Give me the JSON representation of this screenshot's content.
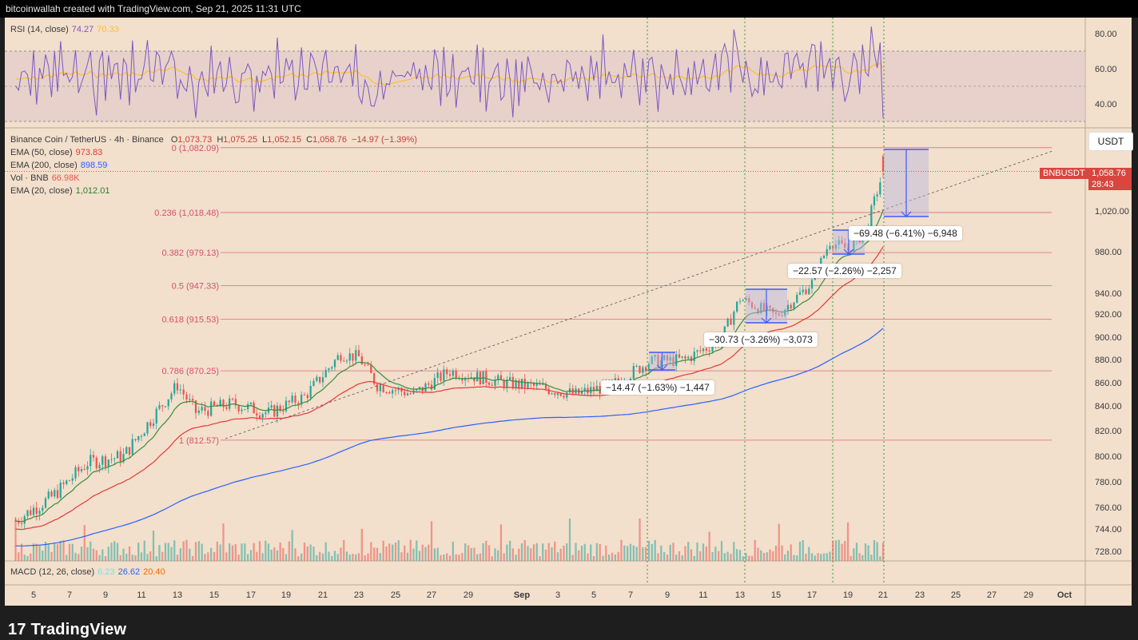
{
  "header": {
    "attribution": "bitcoinwallah created with TradingView.com, Sep 21, 2025 11:31 UTC"
  },
  "rsi": {
    "label": "RSI (14, close)",
    "value": "74.27",
    "ma_value": "70.33",
    "ticks": [
      "80.00",
      "60.00",
      "40.00"
    ]
  },
  "main": {
    "symbol": "Binance Coin / TetherUS · 4h · Binance",
    "ohlc": {
      "o_label": "O",
      "o": "1,073.73",
      "h_label": "H",
      "h": "1,075.25",
      "l_label": "L",
      "l": "1,052.15",
      "c_label": "C",
      "c": "1,058.76",
      "change": "−14.97 (−1.39%)"
    },
    "ema50": {
      "label": "EMA (50, close)",
      "value": "973.83"
    },
    "ema200": {
      "label": "EMA (200, close)",
      "value": "898.59"
    },
    "vol": {
      "label": "Vol · BNB",
      "value": "66.98K"
    },
    "ema20": {
      "label": "EMA (20, close)",
      "value": "1,012.01"
    },
    "currency": "USDT",
    "price_ticks": [
      "1,020.00",
      "980.00",
      "940.00",
      "920.00",
      "900.00",
      "880.00",
      "860.00",
      "840.00",
      "820.00",
      "800.00",
      "780.00",
      "760.00",
      "744.00",
      "728.00"
    ],
    "symbol_tag": "BNBUSDT",
    "last_price": "1,058.76",
    "countdown": "28:43",
    "fib_levels": [
      {
        "label": "0 (1,082.09)",
        "price": 1082.09
      },
      {
        "label": "0.236 (1,018.48)",
        "price": 1018.48
      },
      {
        "label": "0.382 (979.13)",
        "price": 979.13
      },
      {
        "label": "0.5 (947.33)",
        "price": 947.33
      },
      {
        "label": "0.618 (915.53)",
        "price": 915.53
      },
      {
        "label": "0.786 (870.25)",
        "price": 870.25
      },
      {
        "label": "1 (812.57)",
        "price": 812.57
      }
    ],
    "measurements": [
      {
        "text": "−14.47 (−1.63%) −1,447"
      },
      {
        "text": "−30.73 (−3.26%) −3,073"
      },
      {
        "text": "−22.57 (−2.26%) −2,257"
      },
      {
        "text": "−69.48 (−6.41%) −6,948"
      }
    ]
  },
  "macd": {
    "label": "MACD (12, 26, close)",
    "v1": "6.23",
    "v2": "26.62",
    "v3": "20.40"
  },
  "x_axis": {
    "labels": [
      "5",
      "7",
      "9",
      "11",
      "13",
      "15",
      "17",
      "19",
      "21",
      "23",
      "25",
      "27",
      "29",
      "Sep",
      "3",
      "5",
      "7",
      "9",
      "11",
      "13",
      "15",
      "17",
      "19",
      "21",
      "23",
      "25",
      "27",
      "29",
      "Oct"
    ]
  },
  "branding": {
    "logo_text": "TradingView",
    "logo_mark": "17"
  },
  "colors": {
    "up": "#26a69a",
    "down": "#ef5350",
    "ema50": "#e53935",
    "ema200": "#2962ff",
    "ema20": "#388e3c",
    "rsi": "#7e57c2",
    "rsi_ma": "#fbc02d",
    "fib": "#d94f6a"
  },
  "chart_data": {
    "type": "candlestick",
    "title": "Binance Coin / TetherUS · 4h · Binance",
    "xlabel": "",
    "ylabel": "USDT",
    "ylim": [
      720,
      1090
    ],
    "x_range": [
      "Aug 4",
      "Oct 1"
    ],
    "keypoints_close": [
      [
        "Aug 4",
        750
      ],
      [
        "Aug 6",
        768
      ],
      [
        "Aug 8",
        795
      ],
      [
        "Aug 10",
        800
      ],
      [
        "Aug 12",
        838
      ],
      [
        "Aug 13",
        858
      ],
      [
        "Aug 14",
        835
      ],
      [
        "Aug 16",
        842
      ],
      [
        "Aug 18",
        834
      ],
      [
        "Aug 20",
        848
      ],
      [
        "Aug 22",
        885
      ],
      [
        "Aug 23",
        882
      ],
      [
        "Aug 24",
        858
      ],
      [
        "Aug 26",
        850
      ],
      [
        "Aug 28",
        870
      ],
      [
        "Aug 31",
        860
      ],
      [
        "Sep 2",
        856
      ],
      [
        "Sep 4",
        850
      ],
      [
        "Sep 6",
        858
      ],
      [
        "Sep 8",
        878
      ],
      [
        "Sep 10",
        880
      ],
      [
        "Sep 12",
        898
      ],
      [
        "Sep 13",
        935
      ],
      [
        "Sep 15",
        918
      ],
      [
        "Sep 17",
        950
      ],
      [
        "Sep 18",
        990
      ],
      [
        "Sep 19",
        982
      ],
      [
        "Sep 20",
        1000
      ],
      [
        "Sep 21",
        1058.76
      ]
    ],
    "indicators": {
      "ema20": 1012.01,
      "ema50": 973.83,
      "ema200": 898.59,
      "rsi14": 74.27,
      "rsi_ma": 70.33,
      "volume": "66.98K"
    }
  }
}
